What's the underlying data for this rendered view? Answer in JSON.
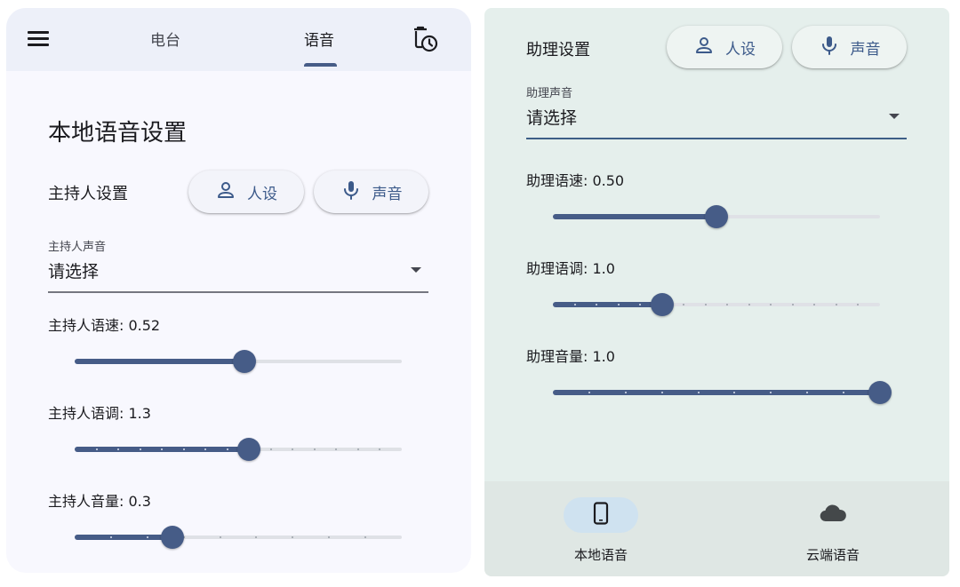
{
  "colors": {
    "accent": "#465c87",
    "chip_text": "#3c5a8a",
    "left_bg": "#f8f8fe",
    "right_bg": "#e5efec"
  },
  "tabs": [
    {
      "label": "电台",
      "selected": false
    },
    {
      "label": "语音",
      "selected": true
    }
  ],
  "icons": {
    "menu": "menu-icon",
    "history": "delete-clock-icon",
    "person": "person-icon",
    "mic": "mic-icon",
    "phone": "smartphone-icon",
    "cloud": "cloud-icon"
  },
  "local": {
    "title": "本地语音设置",
    "host": {
      "label": "主持人设置",
      "persona_chip": "人设",
      "voice_chip": "声音",
      "voice_field": {
        "label": "主持人声音",
        "value": "请选择"
      },
      "sliders": [
        {
          "label": "主持人语速: 0.52",
          "value": 0.52,
          "min": 0,
          "max": 1,
          "steps": 0
        },
        {
          "label": "主持人语调: 1.3",
          "value": 1.3,
          "min": 0.5,
          "max": 2.0,
          "steps": 15
        },
        {
          "label": "主持人音量: 0.3",
          "value": 0.3,
          "min": 0,
          "max": 1,
          "steps": 9
        }
      ]
    },
    "assistant": {
      "label": "助理设置",
      "persona_chip": "人设",
      "voice_chip": "声音",
      "voice_field": {
        "label": "助理声音",
        "value": "请选择"
      },
      "sliders": [
        {
          "label": "助理语速: 0.50",
          "value": 0.5,
          "min": 0,
          "max": 1,
          "steps": 0
        },
        {
          "label": "助理语调: 1.0",
          "value": 1.0,
          "min": 0.5,
          "max": 2.0,
          "steps": 15
        },
        {
          "label": "助理音量: 1.0",
          "value": 1.0,
          "min": 0,
          "max": 1,
          "steps": 9
        }
      ]
    }
  },
  "bottom_nav": [
    {
      "label": "本地语音",
      "selected": true
    },
    {
      "label": "云端语音",
      "selected": false
    }
  ]
}
